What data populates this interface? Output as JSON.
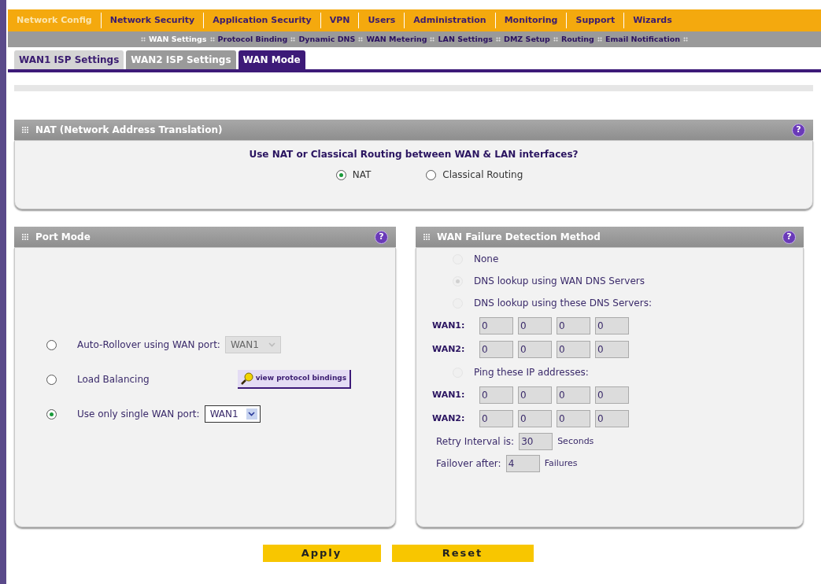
{
  "main_menu": [
    {
      "label": "Network Config",
      "selected": true
    },
    {
      "label": "Network Security",
      "selected": false
    },
    {
      "label": "Application Security",
      "selected": false
    },
    {
      "label": "VPN",
      "selected": false
    },
    {
      "label": "Users",
      "selected": false
    },
    {
      "label": "Administration",
      "selected": false
    },
    {
      "label": "Monitoring",
      "selected": false
    },
    {
      "label": "Support",
      "selected": false
    },
    {
      "label": "Wizards",
      "selected": false
    }
  ],
  "sub_menu": [
    {
      "label": "WAN Settings",
      "selected": true
    },
    {
      "label": "Protocol Binding",
      "selected": false
    },
    {
      "label": "Dynamic DNS",
      "selected": false
    },
    {
      "label": "WAN Metering",
      "selected": false
    },
    {
      "label": "LAN Settings",
      "selected": false
    },
    {
      "label": "DMZ Setup",
      "selected": false
    },
    {
      "label": "Routing",
      "selected": false
    },
    {
      "label": "Email Notification",
      "selected": false
    }
  ],
  "tabs": [
    {
      "label": "WAN1 ISP Settings",
      "selected": false,
      "disabled": false
    },
    {
      "label": "WAN2 ISP Settings",
      "selected": false,
      "disabled": true
    },
    {
      "label": "WAN Mode",
      "selected": true,
      "disabled": false
    }
  ],
  "nat_panel": {
    "title": "NAT (Network Address Translation)",
    "help": "?",
    "question": "Use NAT or Classical Routing between WAN & LAN interfaces?",
    "options": [
      {
        "label": "NAT",
        "selected": true
      },
      {
        "label": "Classical Routing",
        "selected": false
      }
    ]
  },
  "port_mode": {
    "title": "Port Mode",
    "help": "?",
    "options": [
      {
        "kind": "dropdown",
        "label": "Auto-Rollover using WAN port:",
        "selected": false,
        "value": "WAN1",
        "disabled": true
      },
      {
        "kind": "button",
        "label": "Load Balancing",
        "selected": false,
        "button": "view protocol bindings"
      },
      {
        "kind": "dropdown",
        "label": "Use only single WAN port:",
        "selected": true,
        "value": "WAN1",
        "disabled": false
      }
    ]
  },
  "wan_failure": {
    "title": "WAN Failure Detection Method",
    "help": "?",
    "items": [
      {
        "kind": "radio",
        "label": "None",
        "selected": false,
        "disabled": true
      },
      {
        "kind": "radio",
        "label": "DNS lookup using WAN DNS Servers",
        "selected": true,
        "disabled": true
      },
      {
        "kind": "radio",
        "label": "DNS lookup using these DNS Servers:",
        "selected": false,
        "disabled": true
      },
      {
        "kind": "ip",
        "label": "WAN1:",
        "octets": [
          "0",
          "0",
          "0",
          "0"
        ]
      },
      {
        "kind": "ip",
        "label": "WAN2:",
        "octets": [
          "0",
          "0",
          "0",
          "0"
        ]
      },
      {
        "kind": "radio",
        "label": "Ping these IP addresses:",
        "selected": false,
        "disabled": true
      },
      {
        "kind": "ip",
        "label": "WAN1:",
        "octets": [
          "0",
          "0",
          "0",
          "0"
        ]
      },
      {
        "kind": "ip",
        "label": "WAN2:",
        "octets": [
          "0",
          "0",
          "0",
          "0"
        ]
      },
      {
        "kind": "number",
        "label": "Retry Interval is:",
        "value": "30",
        "unit": "Seconds"
      },
      {
        "kind": "number",
        "label": "Failover after:",
        "value": "4",
        "unit": "Failures"
      }
    ]
  },
  "buttons": [
    {
      "label": "Apply"
    },
    {
      "label": "Reset"
    }
  ]
}
